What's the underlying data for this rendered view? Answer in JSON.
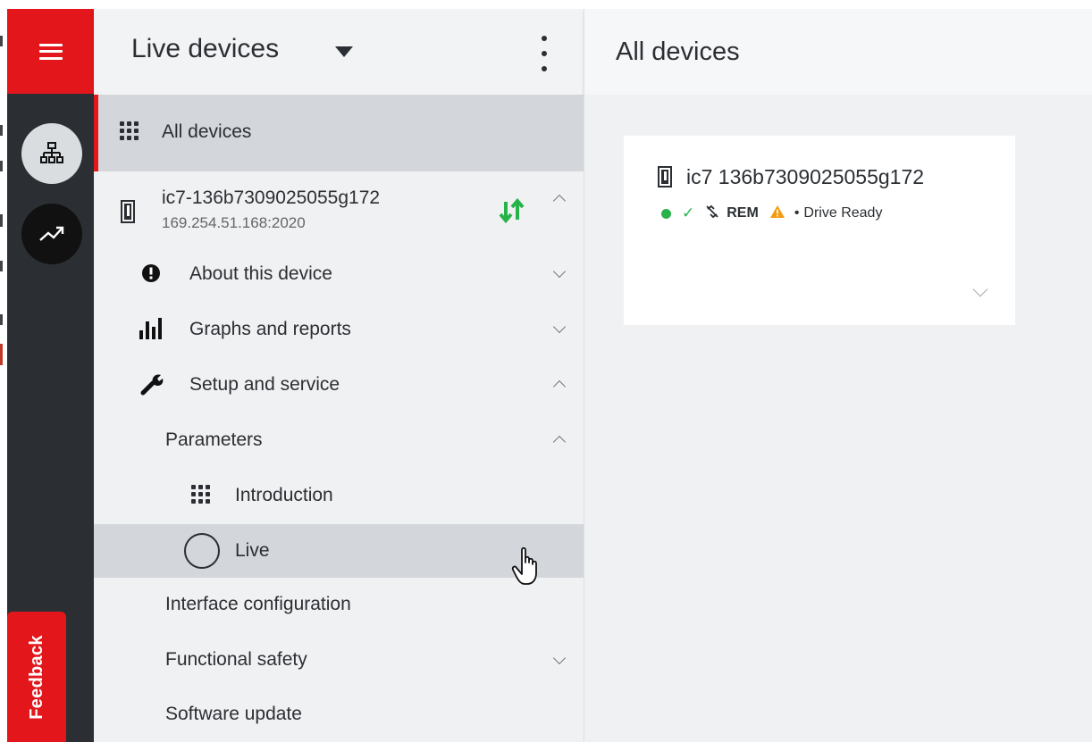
{
  "sidebar": {
    "title": "Live devices",
    "all_devices_label": "All devices",
    "device": {
      "name": "ic7-136b7309025055g172",
      "ip": "169.254.51.168:2020"
    },
    "items": [
      {
        "label": "About this device"
      },
      {
        "label": "Graphs and reports"
      },
      {
        "label": "Setup and service"
      },
      {
        "label": "Parameters"
      },
      {
        "label": "Introduction"
      },
      {
        "label": "Live"
      },
      {
        "label": "Interface configuration"
      },
      {
        "label": "Functional safety"
      },
      {
        "label": "Software update"
      }
    ]
  },
  "feedback_label": "Feedback",
  "main": {
    "title": "All devices",
    "card": {
      "device_name": "ic7 136b7309025055g172",
      "status_mode": "REM",
      "status_text": "Drive Ready"
    }
  },
  "colors": {
    "brand_red": "#e2161b",
    "rail_dark": "#2b2f33",
    "status_green": "#27b34a",
    "warning_orange": "#f39c12"
  },
  "icons": {
    "menu": "hamburger-icon",
    "network": "network-tree-icon",
    "trend": "trend-up-icon",
    "more": "kebab-menu-icon",
    "all_devices": "grid-dots-icon",
    "device": "drive-device-icon",
    "sync": "sync-arrows-icon",
    "about": "info-circle-icon",
    "graphs": "bar-chart-icon",
    "setup": "wrench-icon",
    "introduction": "grid-dots-icon",
    "live": "circle-outline-icon",
    "status_ok": "checkmark-icon",
    "status_link": "no-link-icon",
    "status_warning": "warning-icon"
  }
}
